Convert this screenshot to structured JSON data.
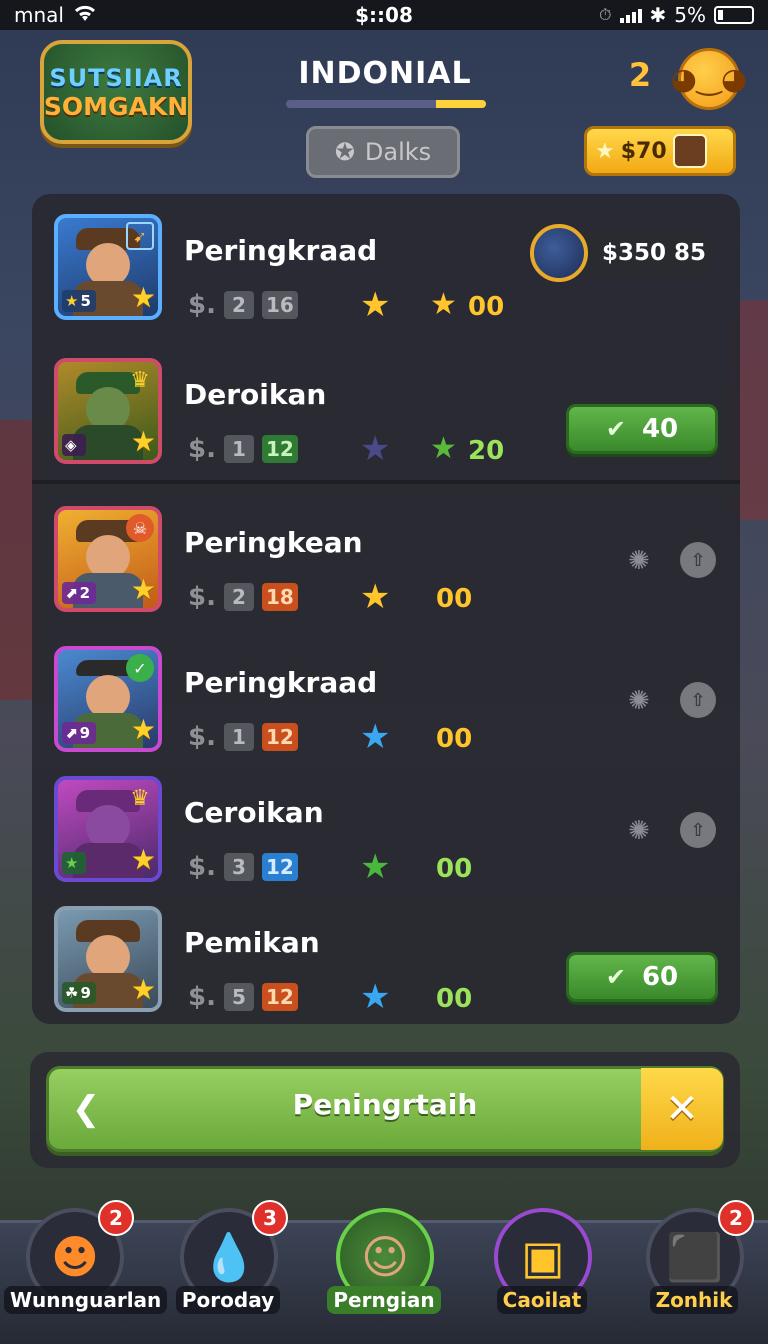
{
  "status_bar": {
    "carrier": "mnal",
    "time": "$::08",
    "battery": "5%"
  },
  "header": {
    "logo_line1": "SUTSIIAR",
    "logo_line2": "SOMGAKN",
    "title": "INDONIAL",
    "title_progress": 0.25,
    "dalks_label": "Dalks",
    "count": "2",
    "gold_label": "$70"
  },
  "rows": [
    {
      "name": "Peringkraad",
      "level": "5",
      "chip1": "2",
      "chip2": "16",
      "score": "00",
      "money": "$350 85"
    },
    {
      "name": "Deroikan",
      "chip1": "1",
      "chip2": "12",
      "score": "20",
      "button": "40"
    },
    {
      "name": "Peringkean",
      "level": "2",
      "chip1": "2",
      "chip2": "18",
      "score": "00"
    },
    {
      "name": "Peringkraad",
      "level": "9",
      "chip1": "1",
      "chip2": "12",
      "score": "00"
    },
    {
      "name": "Ceroikan",
      "chip1": "3",
      "chip2": "12",
      "score": "00"
    },
    {
      "name": "Pemikan",
      "level": "9",
      "chip1": "5",
      "chip2": "12",
      "score": "00",
      "button": "60"
    }
  ],
  "action": {
    "label": "Peningrtaih"
  },
  "nav": [
    {
      "label": "Wunnguarlan",
      "badge": "2"
    },
    {
      "label": "Poroday",
      "badge": "3"
    },
    {
      "label": "Perngian"
    },
    {
      "label": "Caoilat"
    },
    {
      "label": "Zonhik",
      "badge": "2"
    }
  ],
  "colors": {
    "accent_gold": "#ffc52a",
    "accent_green": "#62b54a",
    "panel": "#28282f"
  }
}
